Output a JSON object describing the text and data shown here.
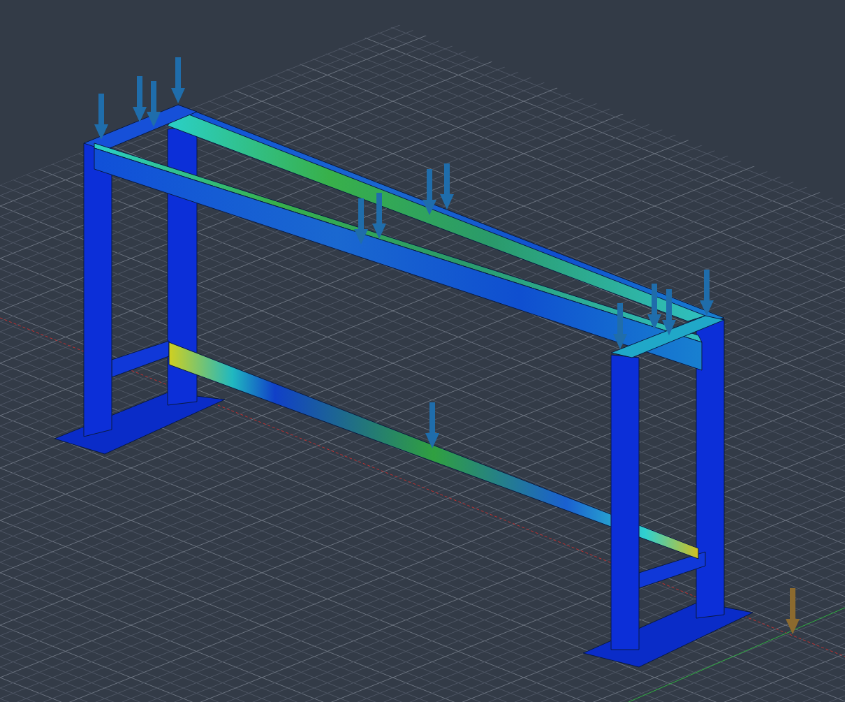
{
  "viewport": {
    "load_arrows": [
      {
        "color": "#1f6dab"
      },
      {
        "color": "#1f6dab"
      },
      {
        "color": "#1f6dab"
      },
      {
        "color": "#1f6dab"
      },
      {
        "color": "#1f6dab"
      },
      {
        "color": "#1f6dab"
      },
      {
        "color": "#1f6dab"
      },
      {
        "color": "#1f6dab"
      },
      {
        "color": "#1f6dab"
      },
      {
        "color": "#1f6dab"
      },
      {
        "color": "#1f6dab"
      },
      {
        "color": "#1f6dab"
      },
      {
        "color": "#1f6dab"
      },
      {
        "color": "#8c6a2e"
      }
    ]
  }
}
